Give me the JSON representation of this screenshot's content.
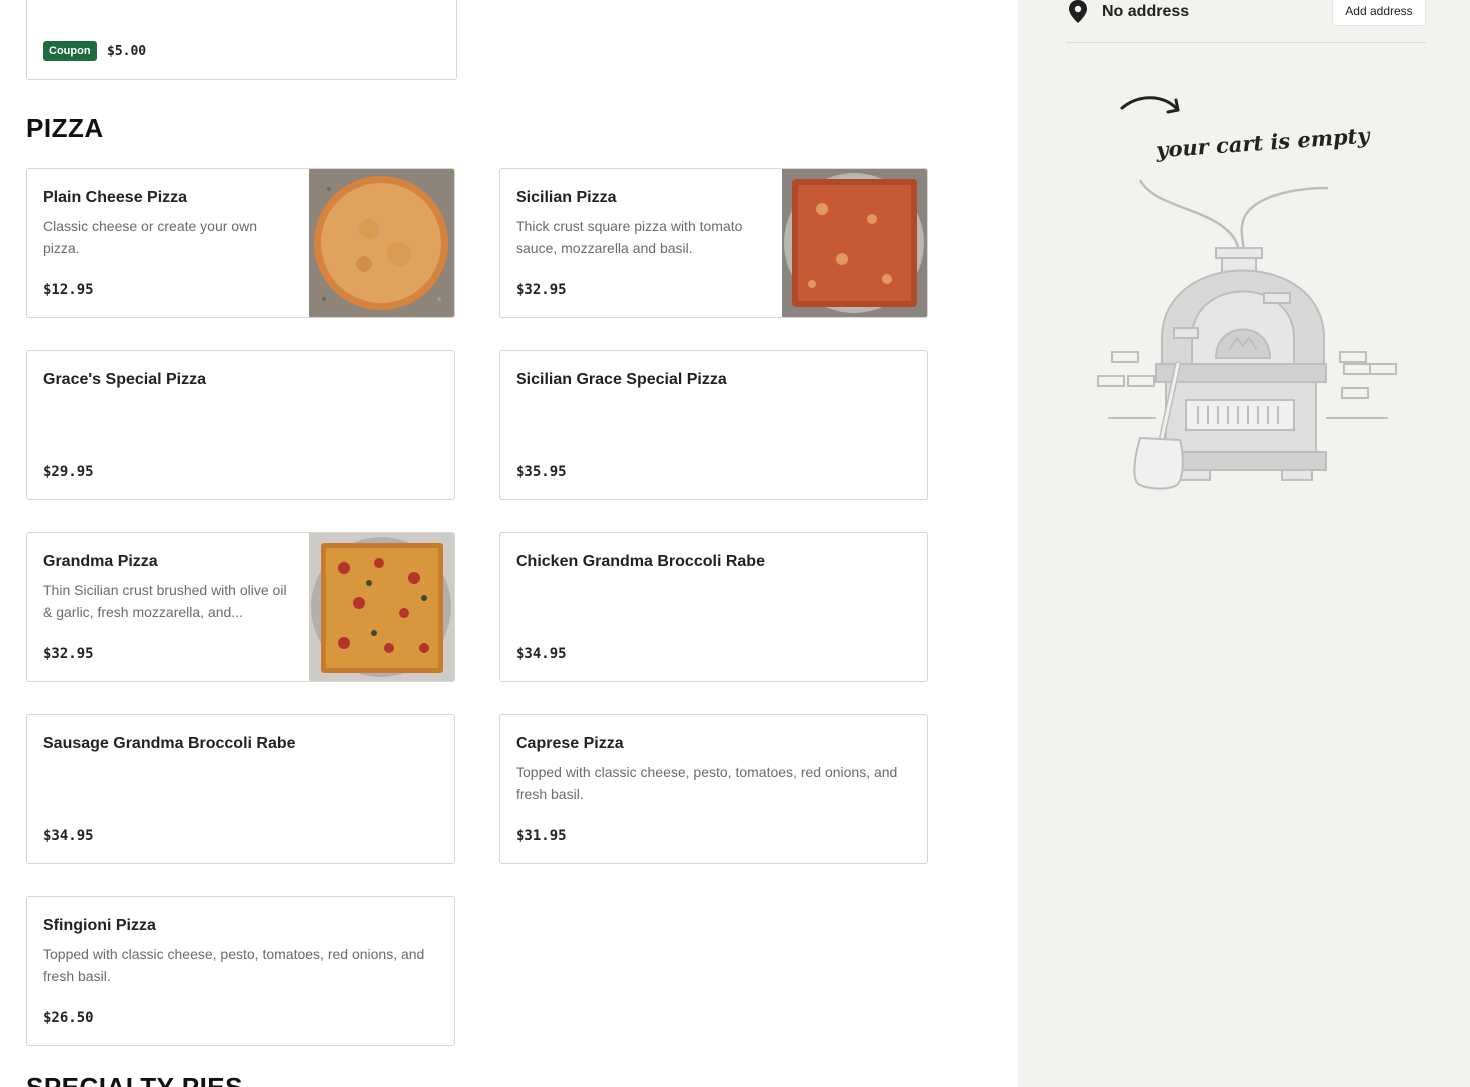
{
  "coupon": {
    "badge": "Coupon",
    "price": "$5.00"
  },
  "section": {
    "title": "PIZZA"
  },
  "next_section": {
    "title": "SPECIALTY PIES"
  },
  "items": [
    {
      "name": "Plain Cheese Pizza",
      "desc": "Classic cheese or create your own pizza.",
      "price": "$12.95"
    },
    {
      "name": "Sicilian Pizza",
      "desc": "Thick crust square pizza with tomato sauce, mozzarella and basil.",
      "price": "$32.95"
    },
    {
      "name": "Grace's Special Pizza",
      "desc": "",
      "price": "$29.95"
    },
    {
      "name": "Sicilian Grace Special Pizza",
      "desc": "",
      "price": "$35.95"
    },
    {
      "name": "Grandma Pizza",
      "desc": "Thin Sicilian crust brushed with olive oil & garlic, fresh mozzarella, and...",
      "price": "$32.95"
    },
    {
      "name": "Chicken Grandma Broccoli Rabe",
      "desc": "",
      "price": "$34.95"
    },
    {
      "name": "Sausage Grandma Broccoli Rabe",
      "desc": "",
      "price": "$34.95"
    },
    {
      "name": "Caprese Pizza",
      "desc": "Topped with classic cheese, pesto, tomatoes, red onions, and fresh basil.",
      "price": "$31.95"
    },
    {
      "name": "Sfingioni Pizza",
      "desc": "Topped with classic cheese, pesto, tomatoes, red onions, and fresh basil.",
      "price": "$26.50"
    }
  ],
  "cart": {
    "address_label": "No address",
    "add_address_button": "Add address",
    "empty_message": "your cart is empty"
  },
  "colors": {
    "coupon_badge": "#1d6b3e",
    "sidebar_bg": "#f3f2ef",
    "border": "#d6d6d6"
  }
}
